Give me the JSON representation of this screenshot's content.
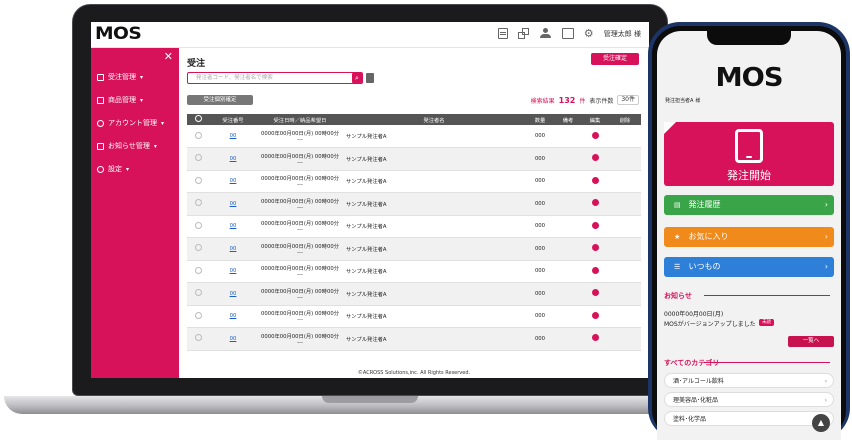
{
  "laptop": {
    "logo": "MOS",
    "admin_name": "管理太郎 様",
    "sidebar": {
      "close": "✕",
      "items": [
        {
          "label": "受注管理",
          "caret": "▾"
        },
        {
          "label": "商品管理",
          "caret": "▾"
        },
        {
          "label": "アカウント管理",
          "caret": "▾"
        },
        {
          "label": "お知らせ管理",
          "caret": "▾"
        },
        {
          "label": "設定",
          "caret": "▾"
        }
      ]
    },
    "page_title": "受注",
    "confirm_button": "受注確定",
    "search_placeholder": "発注者コード、発注者名で検索",
    "bulk_button": "受注個別確定",
    "result_prefix": "検索結果",
    "result_count": "132",
    "result_suffix": "件",
    "per_page_label": "表示件数",
    "per_page_value": "30件",
    "table": {
      "headers": [
        "",
        "受注番号",
        "受注日時／納品希望日",
        "発注者名",
        "数量",
        "備考",
        "編集",
        "削除"
      ],
      "rows": [
        {
          "no": "00",
          "date1": "0000年00月00日(月) 00時00分",
          "date2": "---",
          "name": "サンプル発注者A",
          "qty": "000"
        },
        {
          "no": "00",
          "date1": "0000年00月00日(月) 00時00分",
          "date2": "---",
          "name": "サンプル発注者A",
          "qty": "000"
        },
        {
          "no": "00",
          "date1": "0000年00月00日(月) 00時00分",
          "date2": "---",
          "name": "サンプル発注者A",
          "qty": "000"
        },
        {
          "no": "00",
          "date1": "0000年00月00日(月) 00時00分",
          "date2": "---",
          "name": "サンプル発注者A",
          "qty": "000"
        },
        {
          "no": "00",
          "date1": "0000年00月00日(月) 00時00分",
          "date2": "---",
          "name": "サンプル発注者A",
          "qty": "000"
        },
        {
          "no": "00",
          "date1": "0000年00月00日(月) 00時00分",
          "date2": "---",
          "name": "サンプル発注者A",
          "qty": "000"
        },
        {
          "no": "00",
          "date1": "0000年00月00日(月) 00時00分",
          "date2": "---",
          "name": "サンプル発注者A",
          "qty": "000"
        },
        {
          "no": "00",
          "date1": "0000年00月00日(月) 00時00分",
          "date2": "---",
          "name": "サンプル発注者A",
          "qty": "000"
        },
        {
          "no": "00",
          "date1": "0000年00月00日(月) 00時00分",
          "date2": "---",
          "name": "サンプル発注者A",
          "qty": "000"
        },
        {
          "no": "00",
          "date1": "0000年00月00日(月) 00時00分",
          "date2": "---",
          "name": "サンプル発注者A",
          "qty": "000"
        }
      ]
    },
    "footer": "©ACROSS Solutions,inc. All Rights Reserved."
  },
  "phone": {
    "logo": "MOS",
    "user_name": "発注担当者A",
    "user_suffix": "様",
    "start_label": "発注開始",
    "buttons": [
      {
        "label": "発注履歴",
        "icon": "history-icon",
        "glyph": "▤",
        "arrow": "›"
      },
      {
        "label": "お気に入り",
        "icon": "star-icon",
        "glyph": "★",
        "arrow": "›"
      },
      {
        "label": "いつもの",
        "icon": "list-icon",
        "glyph": "☰",
        "arrow": "›"
      }
    ],
    "news_title": "お知らせ",
    "news_date": "0000年00月00日(月)",
    "news_text": "MOSがバージョンアップしました",
    "news_badge": "未読",
    "list_button": "一覧へ",
    "category_title": "すべてのカテゴリ",
    "categories": [
      {
        "label": "酒･アルコール飲料",
        "arrow": "›"
      },
      {
        "label": "理美容品･化粧品",
        "arrow": "›"
      },
      {
        "label": "塗料･化学品",
        "arrow": "›"
      }
    ]
  },
  "colors": {
    "brand": "#d7125a",
    "green": "#3aa548",
    "orange": "#f08a1a",
    "blue": "#2e7fd8"
  }
}
